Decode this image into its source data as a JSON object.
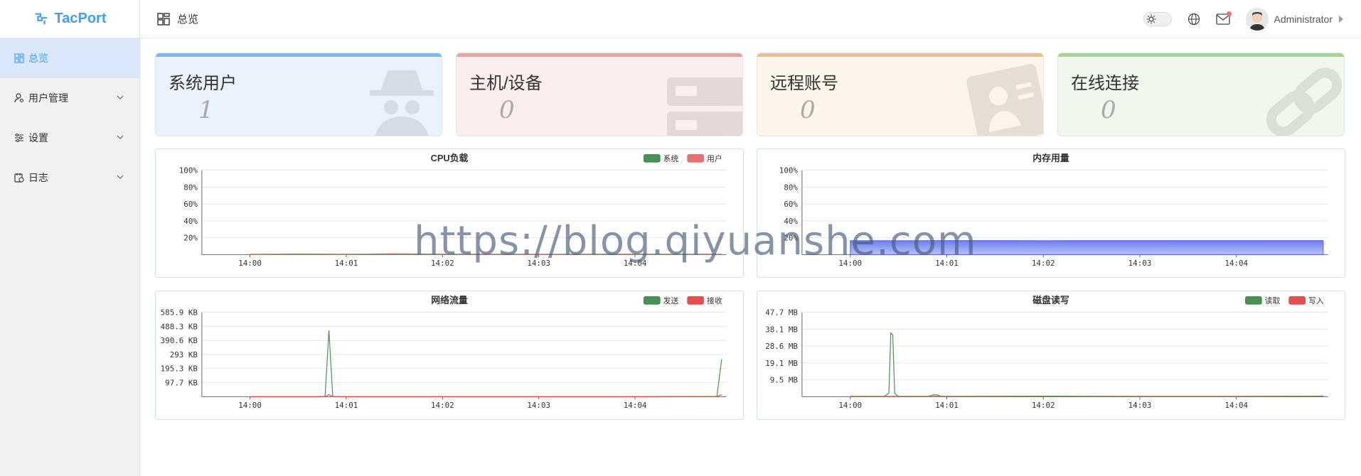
{
  "app": {
    "name": "TacPort"
  },
  "sidebar": {
    "items": [
      {
        "label": "总览",
        "icon": "dashboard-icon",
        "active": true
      },
      {
        "label": "用户管理",
        "icon": "user-manage-icon",
        "active": false
      },
      {
        "label": "设置",
        "icon": "settings-sliders-icon",
        "active": false
      },
      {
        "label": "日志",
        "icon": "log-calendar-icon",
        "active": false
      }
    ]
  },
  "header": {
    "breadcrumb": "总览",
    "user_name": "Administrator"
  },
  "stats": [
    {
      "title": "系统用户",
      "value": "1",
      "accent": "#7bb7f0",
      "bg": "#eaf2fd",
      "icon": "spy-icon"
    },
    {
      "title": "主机/设备",
      "value": "0",
      "accent": "#f0a0a0",
      "bg": "#fdeeee",
      "icon": "server-icon"
    },
    {
      "title": "远程账号",
      "value": "0",
      "accent": "#e9c28a",
      "bg": "#fdf5ea",
      "icon": "id-card-icon"
    },
    {
      "title": "在线连接",
      "value": "0",
      "accent": "#a6d68c",
      "bg": "#f0f7ec",
      "icon": "link-icon"
    }
  ],
  "chart_data": [
    {
      "type": "line",
      "title": "CPU负载",
      "x_ticks": [
        "14:00",
        "14:01",
        "14:02",
        "14:03",
        "14:04"
      ],
      "y_ticks": [
        "100%",
        "80%",
        "60%",
        "40%",
        "20%"
      ],
      "ylim": [
        0,
        100
      ],
      "legend_position": "top-right",
      "series": [
        {
          "name": "系统",
          "color": "#4a8f56",
          "x": [
            0,
            0.5,
            1,
            1.5,
            2,
            2.5,
            3,
            3.5,
            4,
            4.9
          ],
          "values": [
            0.3,
            0.6,
            0.4,
            0.8,
            0.5,
            0.4,
            0.3,
            0.4,
            0.5,
            0.4
          ]
        },
        {
          "name": "用户",
          "color": "#e57373",
          "x": [
            0,
            0.5,
            1,
            1.5,
            2,
            2.5,
            3,
            3.5,
            4,
            4.9
          ],
          "values": [
            0.4,
            0.8,
            0.5,
            1.0,
            0.6,
            0.5,
            0.4,
            0.5,
            0.6,
            0.5
          ]
        }
      ]
    },
    {
      "type": "area",
      "title": "内存用量",
      "x_ticks": [
        "14:00",
        "14:01",
        "14:02",
        "14:03",
        "14:04"
      ],
      "y_ticks": [
        "100%",
        "80%",
        "60%",
        "40%",
        "20%"
      ],
      "ylim": [
        0,
        100
      ],
      "series": [
        {
          "color": "#7f8fef",
          "x": [
            0,
            0.5,
            1,
            1.5,
            2,
            2.5,
            3,
            3.5,
            4,
            4.9
          ],
          "values": [
            16.5,
            16.5,
            16.6,
            16.6,
            16.5,
            16.6,
            16.6,
            16.6,
            16.6,
            16.6
          ]
        }
      ]
    },
    {
      "type": "line",
      "title": "网络流量",
      "x_ticks": [
        "14:00",
        "14:01",
        "14:02",
        "14:03",
        "14:04"
      ],
      "y_ticks": [
        "585.9 KB",
        "488.3 KB",
        "390.6 KB",
        "293 KB",
        "195.3 KB",
        "97.7 KB"
      ],
      "ylim": [
        0,
        585.9
      ],
      "legend_position": "top-right",
      "series": [
        {
          "name": "发送",
          "color": "#4a8f56",
          "x": [
            0,
            0.7,
            0.78,
            0.82,
            0.86,
            0.9,
            1.0,
            2,
            3,
            4,
            4.85,
            4.9
          ],
          "values": [
            0,
            0,
            2,
            460,
            2,
            0,
            0,
            0,
            0,
            0,
            0,
            260
          ]
        },
        {
          "name": "接收",
          "color": "#e0504e",
          "x": [
            0,
            0.78,
            0.82,
            0.86,
            1.0,
            2,
            3,
            4,
            4.85,
            4.9
          ],
          "values": [
            0,
            0,
            14,
            0,
            0,
            0,
            0,
            0,
            2,
            14
          ]
        }
      ]
    },
    {
      "type": "line",
      "title": "磁盘读写",
      "x_ticks": [
        "14:00",
        "14:01",
        "14:02",
        "14:03",
        "14:04"
      ],
      "y_ticks": [
        "47.7 MB",
        "38.1 MB",
        "28.6 MB",
        "19.1 MB",
        "9.5 MB"
      ],
      "ylim": [
        0,
        47.7
      ],
      "legend_position": "top-right",
      "series": [
        {
          "name": "读取",
          "color": "#4a8f56",
          "x": [
            0,
            0.35,
            0.4,
            0.42,
            0.44,
            0.46,
            0.5,
            0.8,
            0.86,
            0.9,
            0.95,
            4.85,
            4.9
          ],
          "values": [
            0,
            0,
            2,
            36,
            35,
            2,
            0,
            0,
            1,
            1,
            0,
            0,
            0.5
          ]
        },
        {
          "name": "写入",
          "color": "#e0504e",
          "x": [
            0,
            1,
            2,
            3,
            4,
            4.9
          ],
          "values": [
            0.2,
            0.2,
            0.3,
            0.2,
            0.2,
            0.3
          ]
        }
      ]
    }
  ],
  "watermark": "https://blog.qiyuanshe.com"
}
